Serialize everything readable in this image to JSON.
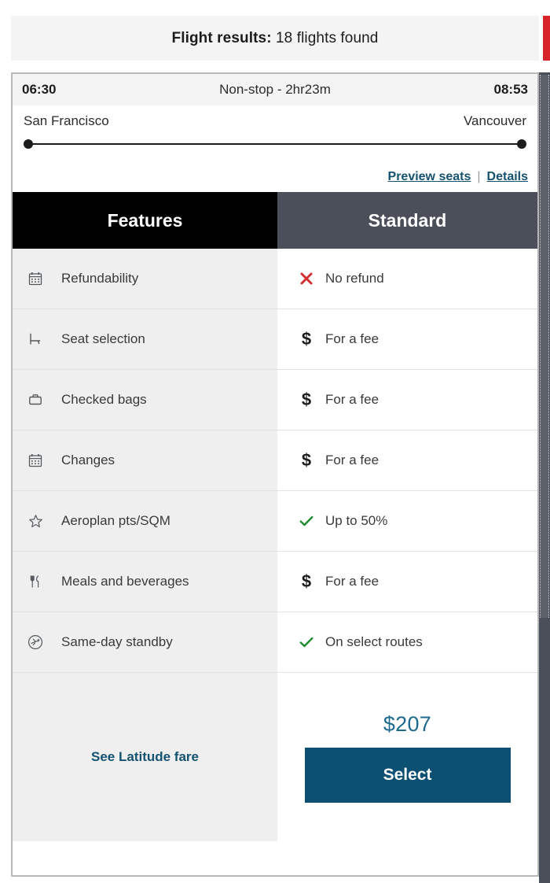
{
  "header": {
    "title_strong": "Flight results:",
    "title_rest": " 18 flights found",
    "accent_color": "#d8232a"
  },
  "flight": {
    "departure_time": "06:30",
    "arrival_time": "08:53",
    "stops_duration": "Non-stop - 2hr23m",
    "origin": "San Francisco",
    "destination": "Vancouver",
    "links": {
      "preview_seats": "Preview seats",
      "separator": "|",
      "details": "Details"
    }
  },
  "comparison": {
    "columns": {
      "features": "Features",
      "fare": "Standard"
    },
    "rows": [
      {
        "icon": "calendar-icon",
        "feature": "Refundability",
        "value_icon": "cross-icon",
        "value": "No refund"
      },
      {
        "icon": "seat-icon",
        "feature": "Seat selection",
        "value_icon": "dollar-icon",
        "value": "For a fee"
      },
      {
        "icon": "briefcase-icon",
        "feature": "Checked bags",
        "value_icon": "dollar-icon",
        "value": "For a fee"
      },
      {
        "icon": "calendar-icon",
        "feature": "Changes",
        "value_icon": "dollar-icon",
        "value": "For a fee"
      },
      {
        "icon": "star-icon",
        "feature": "Aeroplan pts/SQM",
        "value_icon": "check-icon",
        "value": "Up to 50%"
      },
      {
        "icon": "utensils-icon",
        "feature": "Meals and beverages",
        "value_icon": "dollar-icon",
        "value": "For a fee"
      },
      {
        "icon": "standby-plane-icon",
        "feature": "Same-day standby",
        "value_icon": "check-icon",
        "value": "On select routes"
      }
    ],
    "footer": {
      "latitude_link": "See Latitude fare",
      "price": "$207",
      "select_label": "Select"
    }
  },
  "colors": {
    "features_header_bg": "#000000",
    "fare_header_bg": "#4a4f59",
    "select_button_bg": "#0b4f71",
    "price_text": "#1d6a8c",
    "link_blue": "#14526f",
    "cross_red": "#d32f2f",
    "check_green": "#1b8a2c"
  }
}
